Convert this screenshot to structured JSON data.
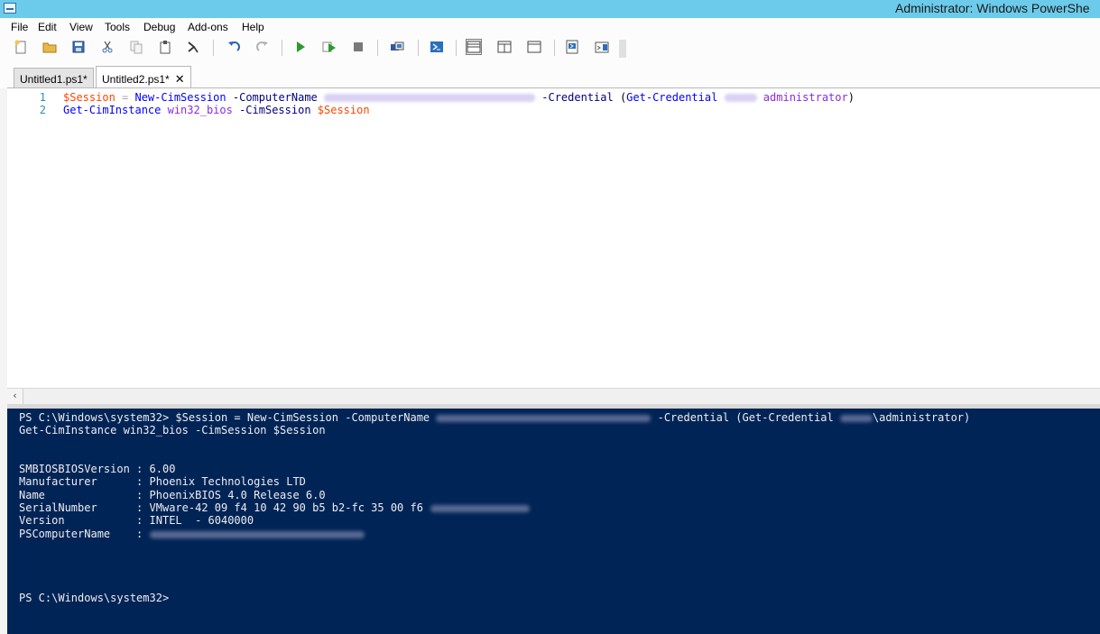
{
  "window": {
    "title": "Administrator: Windows PowerShe"
  },
  "menu": [
    "File",
    "Edit",
    "View",
    "Tools",
    "Debug",
    "Add-ons",
    "Help"
  ],
  "toolbar_icons": [
    "new-script-icon",
    "open-icon",
    "save-icon",
    "cut-icon",
    "copy-icon",
    "paste-icon",
    "console-icon",
    "undo-icon",
    "redo-icon",
    "run-script-icon",
    "run-selection-icon",
    "stop-icon",
    "remote-powershell-icon",
    "powershell-icon",
    "show-script-top-icon",
    "show-script-right-icon",
    "show-script-maximized-icon",
    "show-command-window-icon",
    "show-command-addon-icon"
  ],
  "tabs": [
    {
      "label": "Untitled1.ps1*"
    },
    {
      "label": "Untitled2.ps1*",
      "close": "✕"
    }
  ],
  "editor": {
    "lines": [
      {
        "num": "1",
        "t1": "$Session",
        "t2": " = ",
        "t3": "New-CimSession",
        "t4": " -ComputerName ",
        "t5": " -Credential ",
        "t6": "(",
        "t7": "Get-Credential",
        "t8": " ",
        "t9": "administrator",
        "t10": ")"
      },
      {
        "num": "2",
        "t1": "Get-CimInstance",
        "t2": " win32_bios",
        "t3": " -CimSession ",
        "t4": "$Session"
      }
    ]
  },
  "console": {
    "prompt1_a": "PS C:\\Windows\\system32> $Session = New-CimSession -ComputerName ",
    "prompt1_b": " -Credential (Get-Credential ",
    "prompt1_c": "\\administrator)",
    "line2": "Get-CimInstance win32_bios -CimSession $Session",
    "props": [
      {
        "key": "SMBIOSBIOSVersion",
        "value": "6.00"
      },
      {
        "key": "Manufacturer     ",
        "value": "Phoenix Technologies LTD"
      },
      {
        "key": "Name             ",
        "value": "PhoenixBIOS 4.0 Release 6.0"
      },
      {
        "key": "SerialNumber     ",
        "value": "VMware-42 09 f4 10 42 90 b5 b2-fc 35 00 f6"
      },
      {
        "key": "Version          ",
        "value": "INTEL  - 6040000"
      },
      {
        "key": "PSComputerName   ",
        "value": ""
      }
    ],
    "sep": " : ",
    "final_prompt": "PS C:\\Windows\\system32>"
  }
}
